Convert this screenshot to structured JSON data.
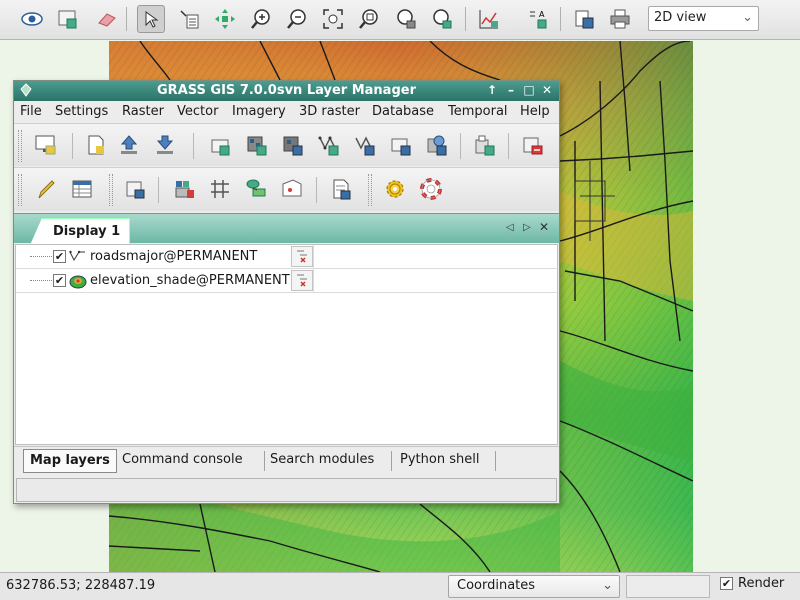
{
  "map_toolbar": {
    "view_mode": "2D view",
    "icons": [
      "eye-icon",
      "add-layer-icon",
      "eraser-icon",
      "pointer-icon",
      "query-icon",
      "pan-icon",
      "zoom-in-icon",
      "zoom-out-icon",
      "zoom-extent-icon",
      "zoom-layer-icon",
      "zoom-back-icon",
      "zoom-menu-icon",
      "analyze-icon",
      "decoration-icon",
      "save-display-icon",
      "print-icon"
    ]
  },
  "layer_manager": {
    "title": "GRASS GIS 7.0.0svn Layer Manager",
    "menu": [
      "File",
      "Settings",
      "Raster",
      "Vector",
      "Imagery",
      "3D raster",
      "Database",
      "Temporal",
      "Help"
    ],
    "display_tab": "Display 1",
    "layers": [
      {
        "name": "roadsmajor@PERMANENT",
        "checked": true,
        "type": "vector"
      },
      {
        "name": "elevation_shade@PERMANENT",
        "checked": true,
        "type": "raster"
      }
    ],
    "bottom_tabs": [
      "Map layers",
      "Command console",
      "Search modules",
      "Python shell"
    ]
  },
  "status_bar": {
    "coordinates": "632786.53; 228487.19",
    "mode": "Coordinates",
    "render_label": "Render",
    "render_checked": true
  },
  "colors": {
    "title_bar": "#2a7266",
    "tab_strip": "#6db8a6"
  }
}
